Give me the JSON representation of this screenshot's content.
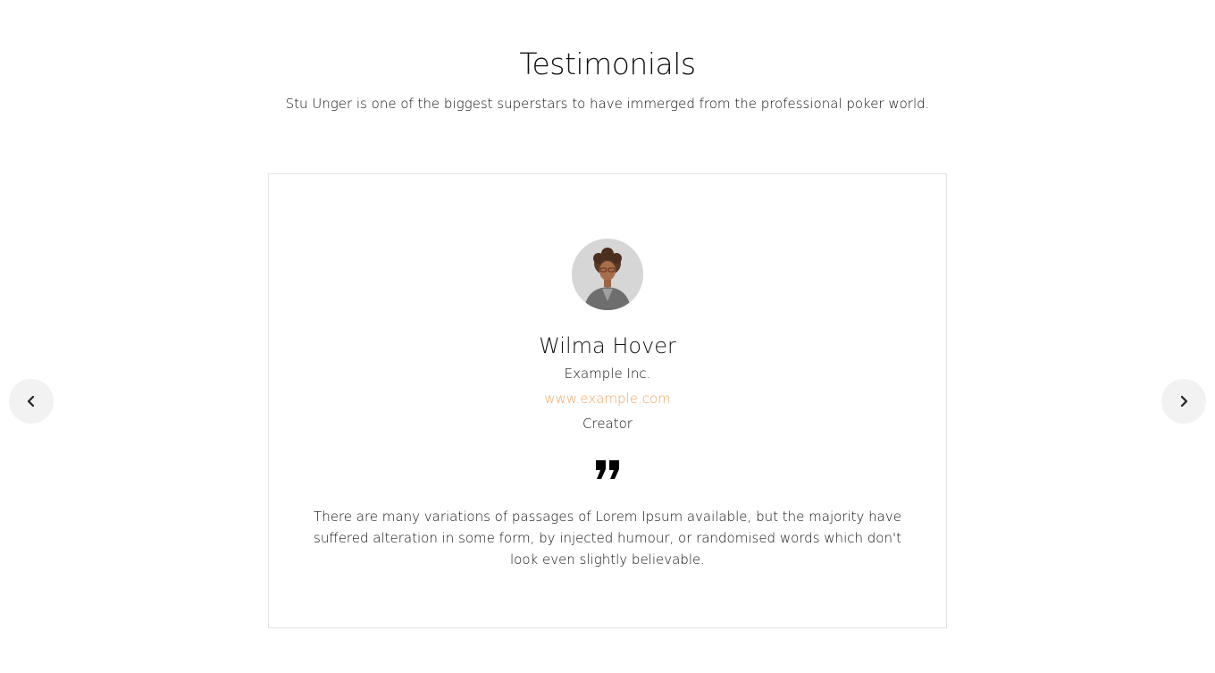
{
  "section": {
    "title": "Testimonials",
    "subtitle": "Stu Unger is one of the biggest superstars to have immerged from the professional poker world."
  },
  "testimonial": {
    "name": "Wilma Hover",
    "company": "Example Inc.",
    "website": "www.example.com",
    "role": "Creator",
    "text": "There are many variations of passages of Lorem Ipsum available, but the majority have suffered alteration in some form, by injected humour, or randomised words which don't look even slightly believable.",
    "accent_color": "#f0a562"
  },
  "navigation": {
    "prev_icon": "chevron-left-icon",
    "next_icon": "chevron-right-icon"
  }
}
